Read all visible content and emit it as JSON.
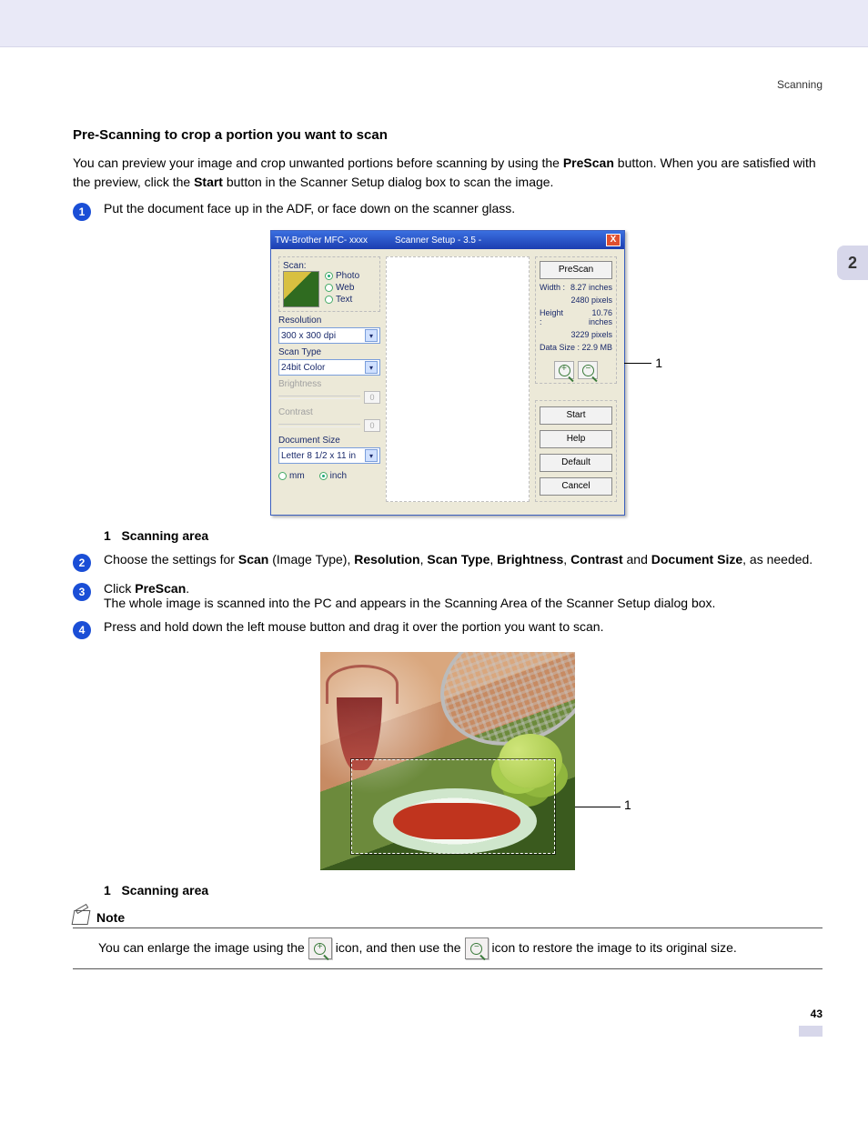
{
  "header": {
    "section": "Scanning"
  },
  "sideTab": "2",
  "heading": "Pre-Scanning to crop a portion you want to scan",
  "intro": {
    "part1": "You can preview your image and crop unwanted portions before scanning by using the ",
    "bold1": "PreScan",
    "part2": " button. When you are satisfied with the preview, click the ",
    "bold2": "Start",
    "part3": " button in the Scanner Setup dialog box to scan the image."
  },
  "steps": {
    "s1": {
      "num": "1",
      "text": "Put the document face up in the ADF, or face down on the scanner glass."
    },
    "s2": {
      "num": "2",
      "t1": "Choose the settings for ",
      "b1": "Scan",
      "t2": " (Image Type), ",
      "b2": "Resolution",
      "t3": ", ",
      "b3": "Scan Type",
      "t4": ", ",
      "b4": "Brightness",
      "t5": ", ",
      "b5": "Contrast",
      "t6": " and ",
      "b6": "Document Size",
      "t7": ", as needed."
    },
    "s3": {
      "num": "3",
      "t1": "Click ",
      "b1": "PreScan",
      "t2": ".",
      "line2": "The whole image is scanned into the PC and appears in the Scanning Area of the Scanner Setup dialog box."
    },
    "s4": {
      "num": "4",
      "text": "Press and hold down the left mouse button and drag it over the portion you want to scan."
    }
  },
  "caption1": {
    "num": "1",
    "text": "Scanning area"
  },
  "caption2": {
    "num": "1",
    "text": "Scanning area"
  },
  "dialog": {
    "title1": "TW-Brother MFC- xxxx",
    "title2": "Scanner Setup - 3.5 -",
    "close": "X",
    "scanLabel": "Scan:",
    "photo": "Photo",
    "web": "Web",
    "text": "Text",
    "resolutionLabel": "Resolution",
    "resolutionValue": "300 x 300 dpi",
    "scanTypeLabel": "Scan Type",
    "scanTypeValue": "24bit Color",
    "brightnessLabel": "Brightness",
    "brightnessValue": "0",
    "contrastLabel": "Contrast",
    "contrastValue": "0",
    "docSizeLabel": "Document Size",
    "docSizeValue": "Letter 8 1/2 x 11 in",
    "mm": "mm",
    "inch": "inch",
    "prescanBtn": "PreScan",
    "width": {
      "k": "Width :",
      "v1": "8.27 inches",
      "v2": "2480 pixels"
    },
    "height": {
      "k": "Height :",
      "v1": "10.76 inches",
      "v2": "3229 pixels"
    },
    "datasize": {
      "k": "Data Size :",
      "v": "22.9 MB"
    },
    "startBtn": "Start",
    "helpBtn": "Help",
    "defaultBtn": "Default",
    "cancelBtn": "Cancel",
    "callout": "1"
  },
  "photoCallout": "1",
  "note": {
    "title": "Note",
    "t1": "You can enlarge the image using the ",
    "t2": " icon, and then use the ",
    "t3": " icon to restore the image to its original size."
  },
  "footer": {
    "page": "43"
  }
}
